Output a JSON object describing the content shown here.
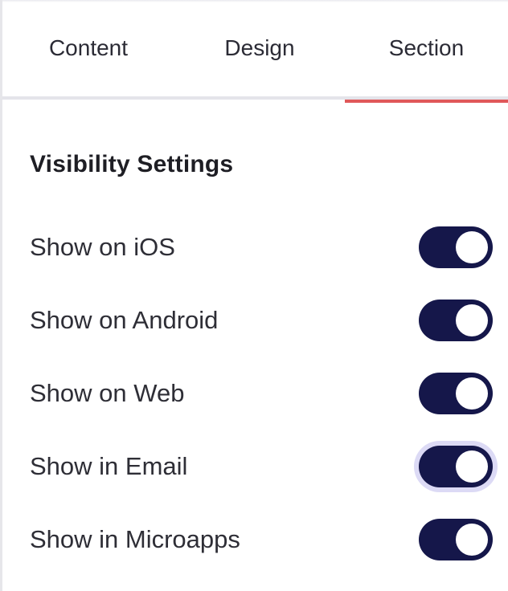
{
  "tabs": [
    {
      "label": "Content",
      "active": false
    },
    {
      "label": "Design",
      "active": false
    },
    {
      "label": "Section",
      "active": true
    }
  ],
  "colors": {
    "active_tab_indicator": "#e0585a",
    "toggle_on": "#15174a",
    "focus_ring": "#dcdaf5"
  },
  "visibility": {
    "title": "Visibility Settings",
    "items": [
      {
        "label": "Show on iOS",
        "enabled": true,
        "focused": false
      },
      {
        "label": "Show on Android",
        "enabled": true,
        "focused": false
      },
      {
        "label": "Show on Web",
        "enabled": true,
        "focused": false
      },
      {
        "label": "Show in Email",
        "enabled": true,
        "focused": true
      },
      {
        "label": "Show in Microapps",
        "enabled": true,
        "focused": false
      }
    ]
  }
}
